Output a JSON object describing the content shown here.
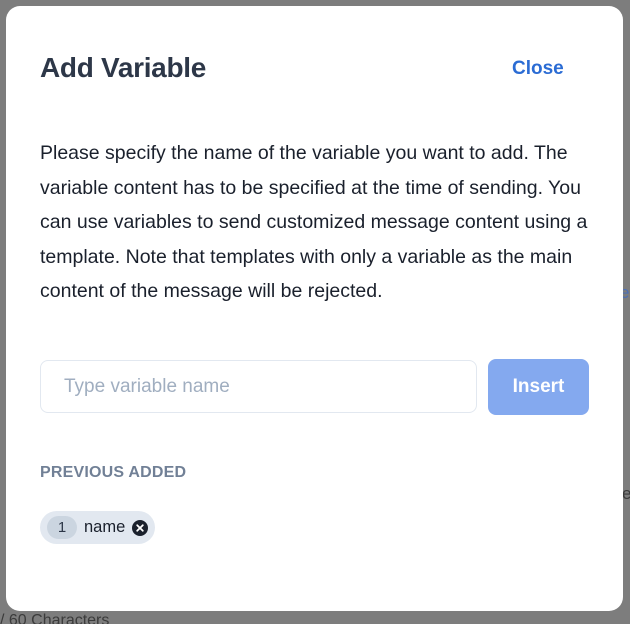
{
  "background": {
    "edge_text_1": "e",
    "edge_text_2": "e",
    "counter_text": "/ 60 Characters"
  },
  "modal": {
    "title": "Add Variable",
    "close_label": "Close",
    "description": "Please specify the name of the variable you want to add. The variable content has to be specified at the time of sending. You can use variables to send customized message content using a template. Note that templates with only a variable as the main content of the message will be rejected.",
    "input": {
      "placeholder": "Type variable name",
      "value": ""
    },
    "insert_label": "Insert",
    "previous_label": "PREVIOUS ADDED",
    "previous_variables": [
      {
        "count": "1",
        "name": "name",
        "remove_icon": "close-circle-icon"
      }
    ]
  },
  "colors": {
    "accent": "#2b6cd4",
    "insert_button": "#84a9ef",
    "title": "#2d3748",
    "muted_label": "#718096",
    "backdrop": "#7d7d7d"
  }
}
